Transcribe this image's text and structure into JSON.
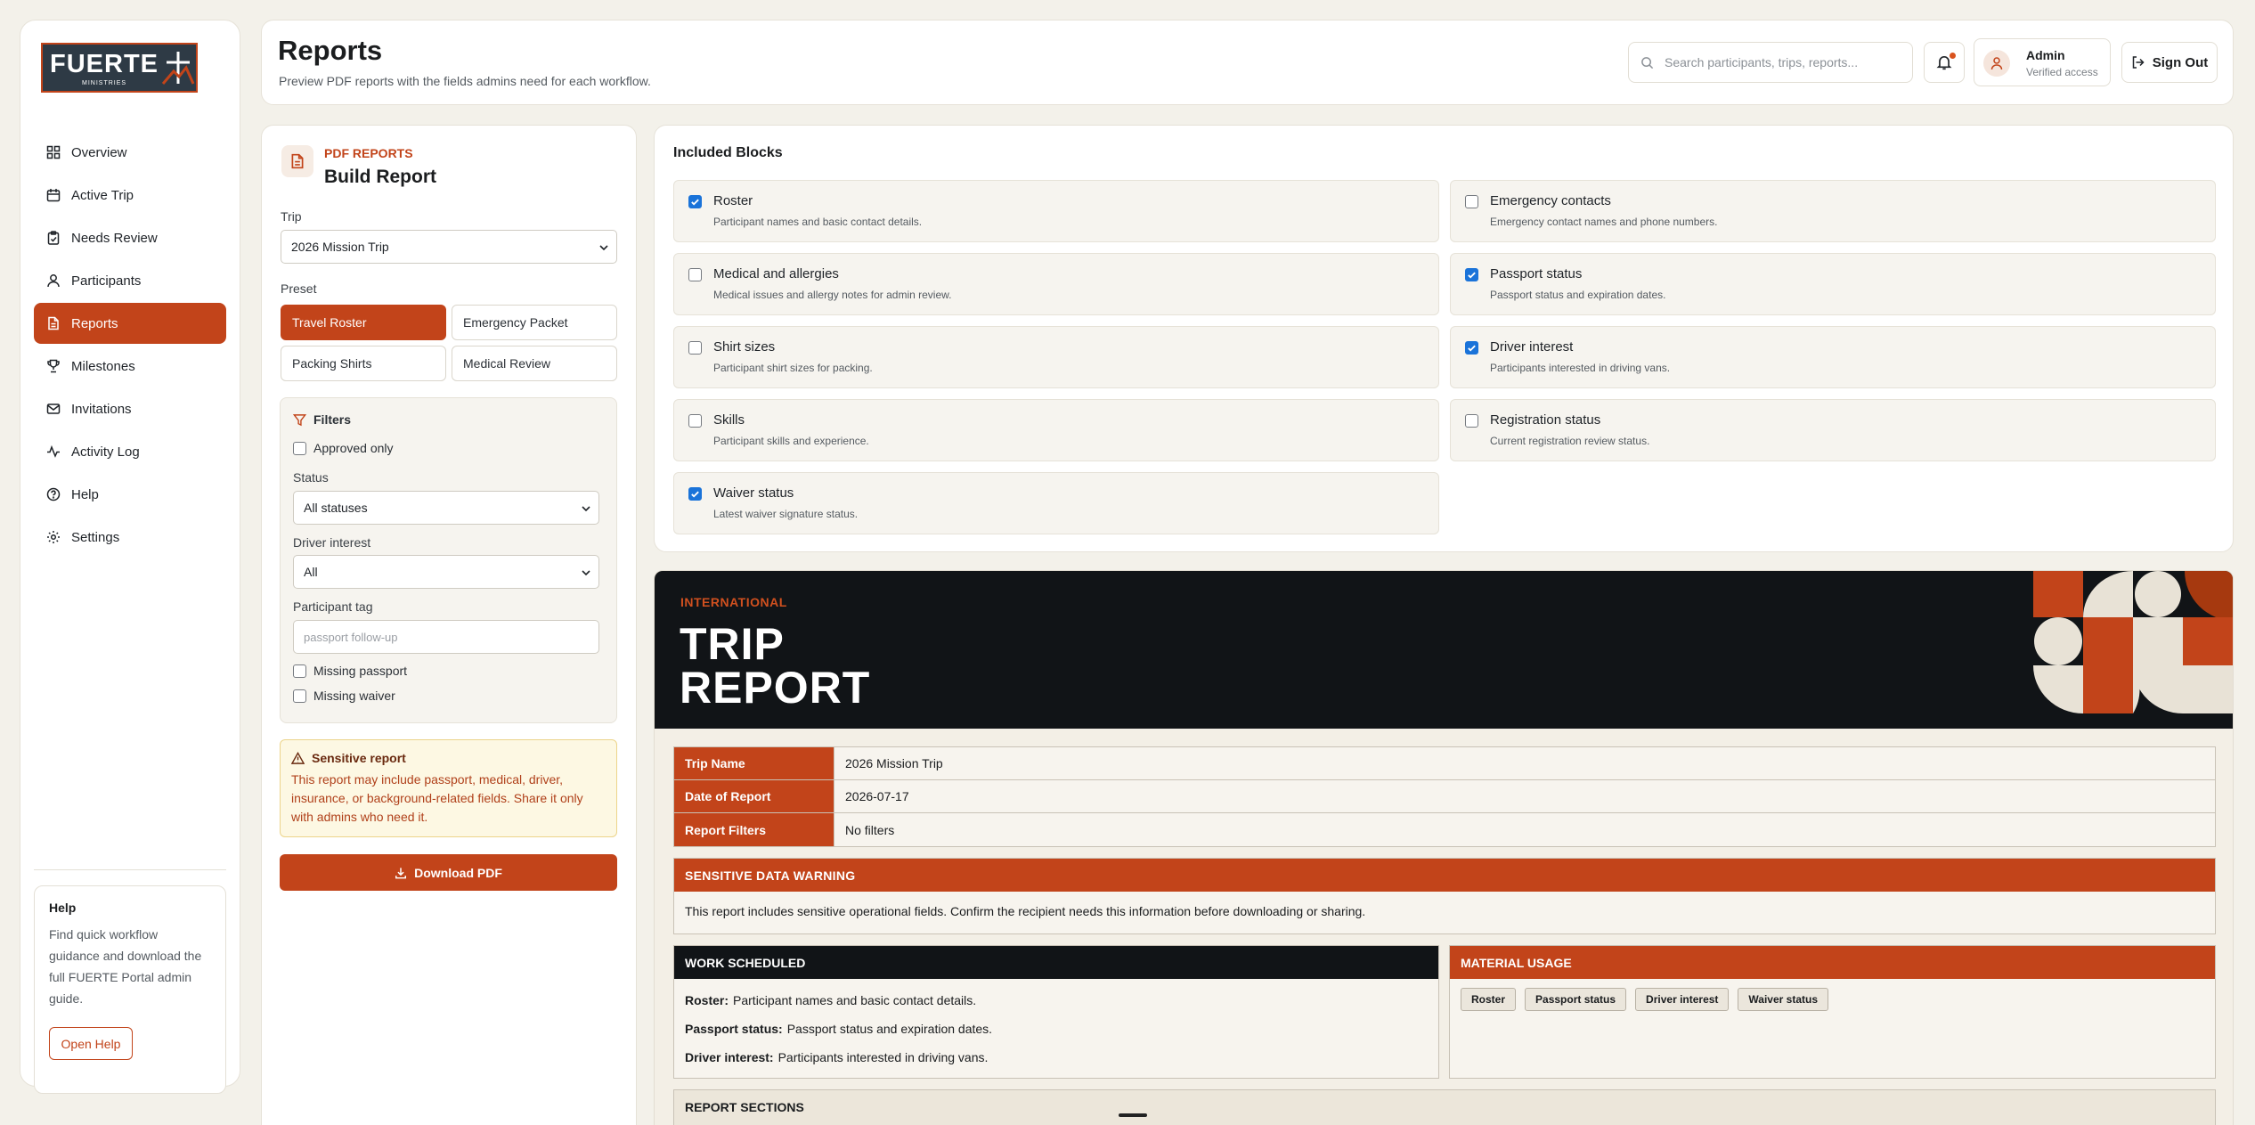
{
  "brand": {
    "logo_word": "FUERTE",
    "logo_sub": "MINISTRIES"
  },
  "colors": {
    "accent": "#c2441a",
    "dark": "#111417",
    "background": "#f3f1ea"
  },
  "sidebar": {
    "items": [
      {
        "label": "Overview",
        "icon": "grid-icon"
      },
      {
        "label": "Active Trip",
        "icon": "calendar-icon"
      },
      {
        "label": "Needs Review",
        "icon": "clipboard-icon"
      },
      {
        "label": "Participants",
        "icon": "user-icon"
      },
      {
        "label": "Reports",
        "icon": "document-icon",
        "active": true
      },
      {
        "label": "Milestones",
        "icon": "trophy-icon"
      },
      {
        "label": "Invitations",
        "icon": "mail-icon"
      },
      {
        "label": "Activity Log",
        "icon": "activity-icon"
      },
      {
        "label": "Help",
        "icon": "help-circle-icon"
      },
      {
        "label": "Settings",
        "icon": "gear-icon"
      }
    ],
    "help": {
      "title": "Help",
      "description": "Find quick workflow guidance and download the full FUERTE Portal admin guide.",
      "button": "Open Help"
    }
  },
  "header": {
    "title": "Reports",
    "subtitle": "Preview PDF reports with the fields admins need for each workflow.",
    "search_placeholder": "Search participants, trips, reports...",
    "user_name": "Admin",
    "user_role": "Verified access",
    "signout": "Sign Out"
  },
  "builder": {
    "eyebrow": "PDF REPORTS",
    "title": "Build Report",
    "trip_label": "Trip",
    "trip_value": "2026 Mission Trip",
    "preset_label": "Preset",
    "presets": [
      "Travel Roster",
      "Emergency Packet",
      "Packing Shirts",
      "Medical Review"
    ],
    "filters": {
      "title": "Filters",
      "approved_only": "Approved only",
      "status_label": "Status",
      "status_value": "All statuses",
      "driver_label": "Driver interest",
      "driver_value": "All",
      "tag_label": "Participant tag",
      "tag_placeholder": "passport follow-up",
      "missing_passport": "Missing passport",
      "missing_waiver": "Missing waiver"
    },
    "warning": {
      "title": "Sensitive report",
      "text": "This report may include passport, medical, driver, insurance, or background-related fields. Share it only with admins who need it."
    },
    "download": "Download PDF"
  },
  "blocks": {
    "heading": "Included Blocks",
    "items": [
      {
        "title": "Roster",
        "desc": "Participant names and basic contact details.",
        "checked": true
      },
      {
        "title": "Emergency contacts",
        "desc": "Emergency contact names and phone numbers.",
        "checked": false
      },
      {
        "title": "Medical and allergies",
        "desc": "Medical issues and allergy notes for admin review.",
        "checked": false
      },
      {
        "title": "Passport status",
        "desc": "Passport status and expiration dates.",
        "checked": true
      },
      {
        "title": "Shirt sizes",
        "desc": "Participant shirt sizes for packing.",
        "checked": false
      },
      {
        "title": "Driver interest",
        "desc": "Participants interested in driving vans.",
        "checked": true
      },
      {
        "title": "Skills",
        "desc": "Participant skills and experience.",
        "checked": false
      },
      {
        "title": "Registration status",
        "desc": "Current registration review status.",
        "checked": false
      },
      {
        "title": "Waiver status",
        "desc": "Latest waiver signature status.",
        "checked": true
      }
    ]
  },
  "preview": {
    "eyebrow": "INTERNATIONAL",
    "title_line1": "TRIP",
    "title_line2": "REPORT",
    "info": [
      {
        "key": "Trip Name",
        "value": "2026 Mission Trip"
      },
      {
        "key": "Date of Report",
        "value": "2026-07-17"
      },
      {
        "key": "Report Filters",
        "value": "No filters"
      }
    ],
    "sensitive_title": "SENSITIVE DATA WARNING",
    "sensitive_text": "This report includes sensitive operational fields. Confirm the recipient needs this information before downloading or sharing.",
    "work_title": "WORK SCHEDULED",
    "work_lines": [
      {
        "label": "Roster:",
        "text": "Participant names and basic contact details."
      },
      {
        "label": "Passport status:",
        "text": "Passport status and expiration dates."
      },
      {
        "label": "Driver interest:",
        "text": "Participants interested in driving vans."
      }
    ],
    "material_title": "MATERIAL USAGE",
    "chips": [
      "Roster",
      "Passport status",
      "Driver interest",
      "Waiver status"
    ],
    "sections_title": "REPORT SECTIONS"
  }
}
